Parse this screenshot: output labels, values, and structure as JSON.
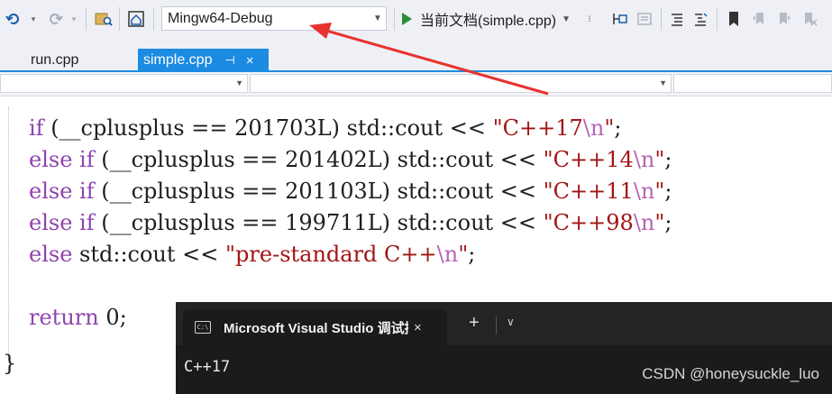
{
  "toolbar": {
    "configuration": "Mingw64-Debug",
    "run_label": "当前文档(simple.cpp)"
  },
  "tabs": [
    {
      "label": "run.cpp",
      "active": false
    },
    {
      "label": "simple.cpp",
      "active": true,
      "pin": "⊣",
      "close": "×"
    }
  ],
  "code": {
    "lines": [
      [
        {
          "t": "if",
          "c": "kw"
        },
        {
          "t": " (__cplusplus == 201703L) std::cout << "
        },
        {
          "t": "\"C++17",
          "c": "str"
        },
        {
          "t": "\\n",
          "c": "esc"
        },
        {
          "t": "\"",
          "c": "str"
        },
        {
          "t": ";"
        }
      ],
      [
        {
          "t": "else if",
          "c": "kw"
        },
        {
          "t": " (__cplusplus == 201402L) std::cout << "
        },
        {
          "t": "\"C++14",
          "c": "str"
        },
        {
          "t": "\\n",
          "c": "esc"
        },
        {
          "t": "\"",
          "c": "str"
        },
        {
          "t": ";"
        }
      ],
      [
        {
          "t": "else if",
          "c": "kw"
        },
        {
          "t": " (__cplusplus == 201103L) std::cout << "
        },
        {
          "t": "\"C++11",
          "c": "str"
        },
        {
          "t": "\\n",
          "c": "esc"
        },
        {
          "t": "\"",
          "c": "str"
        },
        {
          "t": ";"
        }
      ],
      [
        {
          "t": "else if",
          "c": "kw"
        },
        {
          "t": " (__cplusplus == 199711L) std::cout << "
        },
        {
          "t": "\"C++98",
          "c": "str"
        },
        {
          "t": "\\n",
          "c": "esc"
        },
        {
          "t": "\"",
          "c": "str"
        },
        {
          "t": ";"
        }
      ],
      [
        {
          "t": "else",
          "c": "kw"
        },
        {
          "t": " std::cout << "
        },
        {
          "t": "\"pre-standard C++",
          "c": "str"
        },
        {
          "t": "\\n",
          "c": "esc"
        },
        {
          "t": "\"",
          "c": "str"
        },
        {
          "t": ";"
        }
      ],
      [],
      [
        {
          "t": "return",
          "c": "kw"
        },
        {
          "t": " 0;"
        }
      ]
    ],
    "closing_brace": "}"
  },
  "terminal": {
    "tab_title": "Microsoft Visual Studio 调试控制台",
    "close": "×",
    "add": "+",
    "more": "∨",
    "output": "C++17"
  },
  "watermark": "CSDN @honeysuckle_luo",
  "colors": {
    "accent": "#1c8be2",
    "keyword": "#8e44ad",
    "string": "#a31515",
    "annotation_arrow": "#e8322f",
    "terminal_bg": "#1b1b1b"
  },
  "icons": [
    "undo-icon",
    "redo-icon",
    "find-in-files-icon",
    "solution-explorer-icon",
    "play-icon",
    "comment-icon",
    "bookmark-icon"
  ]
}
